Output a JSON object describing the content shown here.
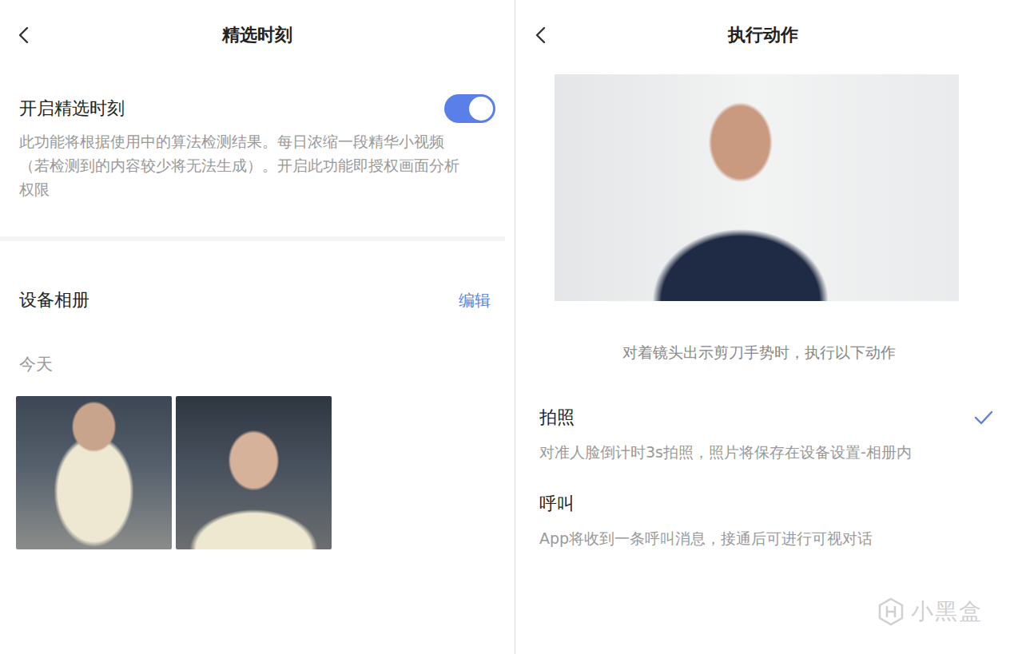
{
  "left": {
    "title": "精选时刻",
    "toggle": {
      "label": "开启精选时刻",
      "on": true,
      "description": "此功能将根据使用中的算法检测结果。每日浓缩一段精华小视频（若检测到的内容较少将无法生成）。开启此功能即授权画面分析权限"
    },
    "album": {
      "title": "设备相册",
      "edit": "编辑",
      "group": "今天",
      "photos": [
        {
          "kind": "full-body"
        },
        {
          "kind": "half-body"
        }
      ]
    }
  },
  "right": {
    "title": "执行动作",
    "prompt": "对着镜头出示剪刀手势时，执行以下动作",
    "actions": [
      {
        "label": "拍照",
        "description": "对准人脸倒计时3s拍照，照片将保存在设备设置-相册内",
        "selected": true
      },
      {
        "label": "呼叫",
        "description": "App将收到一条呼叫消息，接通后可进行可视对话",
        "selected": false
      }
    ]
  },
  "watermark": {
    "text": "小黑盒"
  }
}
